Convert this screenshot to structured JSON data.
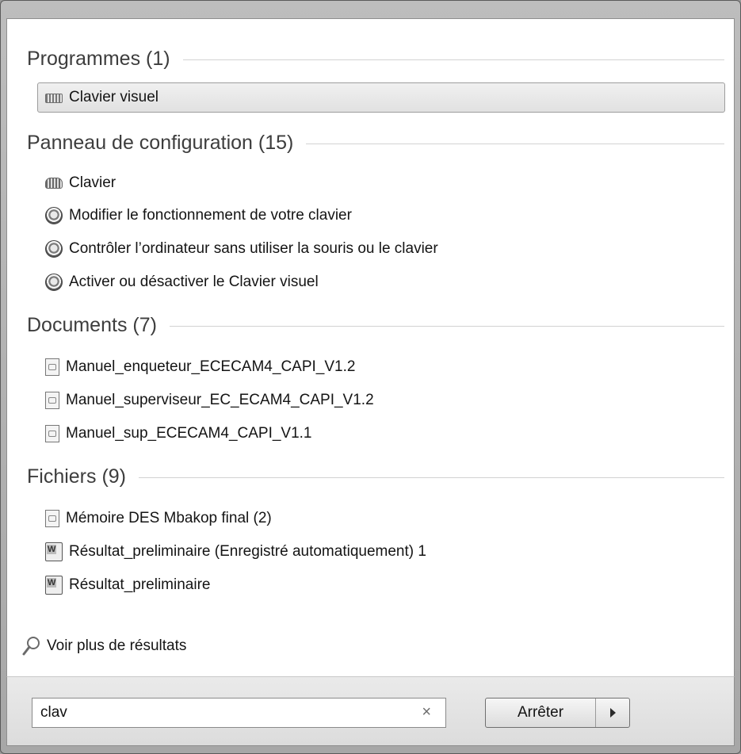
{
  "sections": {
    "programmes": {
      "title": "Programmes (1)",
      "items": [
        "Clavier visuel"
      ]
    },
    "panneau": {
      "title": "Panneau de configuration (15)",
      "items": [
        "Clavier",
        "Modifier le fonctionnement de votre clavier",
        "Contrôler l’ordinateur sans utiliser la souris ou le clavier",
        "Activer ou désactiver le Clavier visuel"
      ]
    },
    "documents": {
      "title": "Documents (7)",
      "items": [
        "Manuel_enqueteur_ECECAM4_CAPI_V1.2",
        "Manuel_superviseur_EC_ECAM4_CAPI_V1.2",
        "Manuel_sup_ECECAM4_CAPI_V1.1"
      ]
    },
    "fichiers": {
      "title": "Fichiers (9)",
      "items": [
        "Mémoire DES Mbakop final (2)",
        "Résultat_preliminaire (Enregistré automatiquement) 1",
        "Résultat_preliminaire"
      ]
    }
  },
  "more_results": "Voir plus de résultats",
  "search": {
    "value": "clav",
    "clear_glyph": "×"
  },
  "shutdown_button": {
    "label": "Arrêter"
  },
  "icons": {
    "onscreen_keyboard": "keyboard-icon",
    "keyboard": "keyboard-icon",
    "ease_of_access": "ease-of-access-icon",
    "document": "document-icon",
    "word_document": "word-document-icon",
    "search": "magnifier-icon",
    "arrow": "arrow-right-icon"
  }
}
